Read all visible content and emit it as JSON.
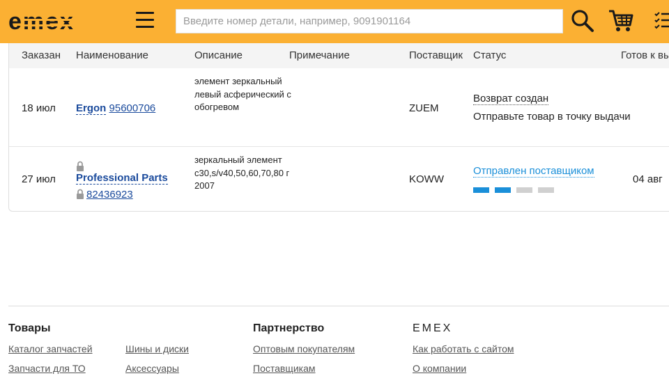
{
  "header": {
    "logo_text": "emex",
    "search_placeholder": "Введите номер детали, например, 9091901164"
  },
  "table": {
    "columns": [
      "Заказан",
      "Наименование",
      "Описание",
      "Примечание",
      "Поставщик",
      "Статус",
      "Готов к вы"
    ],
    "rows": [
      {
        "date": "18 июл",
        "brand": "Ergon",
        "part_number": "95600706",
        "description": "элемент зеркальный левый асферический с обогревом",
        "note": "",
        "supplier": "ZUEM",
        "status": "Возврат создан",
        "status_sub": "Отправьте товар в точку выдачи",
        "ready": ""
      },
      {
        "date": "27 июл",
        "brand": "Professional Parts",
        "part_number": "82436923",
        "description": "зеркальный элемент c30,s/v40,50,60,70,80 г 2007",
        "note": "",
        "supplier": "KOWW",
        "status": "Отправлен поставщиком",
        "progress_completed_steps": 2,
        "progress_total_steps": 4,
        "ready": "04 авг"
      }
    ]
  },
  "footer": {
    "sections": [
      {
        "title": "Товары",
        "links": [
          "Каталог запчастей",
          "Запчасти для ТО"
        ]
      },
      {
        "title": "",
        "links": [
          "Шины и диски",
          "Аксессуары"
        ]
      },
      {
        "title": "Партнерство",
        "links": [
          "Оптовым покупателям",
          "Поставщикам"
        ]
      },
      {
        "title": "EMEX",
        "links": [
          "Как работать с сайтом",
          "О компании"
        ]
      }
    ]
  },
  "colors": {
    "brand_orange": "#fbb033",
    "link_blue": "#1a4a9c",
    "status_blue": "#1a8fd9",
    "progress_done": "#1a8fd9",
    "progress_todo": "#d0d0d0"
  },
  "icons": {
    "menu": "hamburger-icon",
    "search": "magnifier-icon",
    "cart": "cart-icon",
    "orders": "checklist-icon",
    "lock": "lock-icon"
  }
}
